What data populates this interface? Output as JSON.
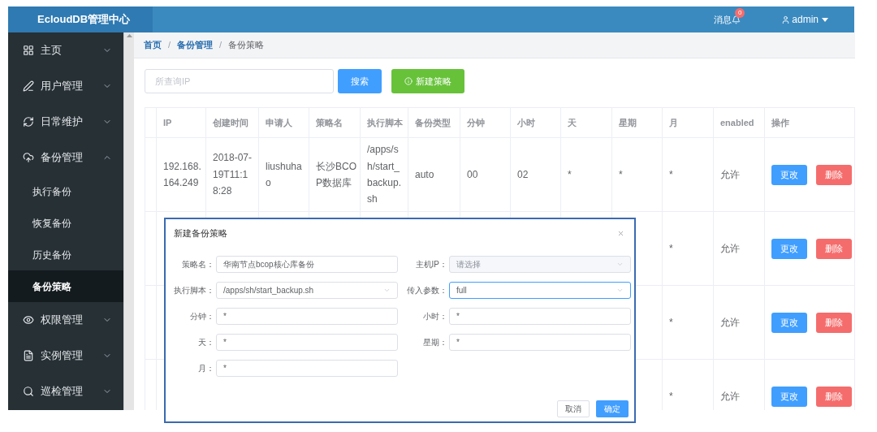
{
  "app": {
    "title": "EcloudDB管理中心"
  },
  "header": {
    "messages": {
      "label": "消息",
      "badge": "0"
    },
    "user": "admin"
  },
  "sidebar": {
    "items": [
      {
        "label": "主页",
        "expanded": false
      },
      {
        "label": "用户管理",
        "expanded": false
      },
      {
        "label": "日常维护",
        "expanded": false
      },
      {
        "label": "备份管理",
        "expanded": true,
        "children": [
          {
            "label": "执行备份",
            "selected": false
          },
          {
            "label": "恢复备份",
            "selected": false
          },
          {
            "label": "历史备份",
            "selected": false
          },
          {
            "label": "备份策略",
            "selected": true
          }
        ]
      },
      {
        "label": "权限管理",
        "expanded": false
      },
      {
        "label": "实例管理",
        "expanded": false
      },
      {
        "label": "巡检管理",
        "expanded": false
      }
    ]
  },
  "breadcrumb": [
    {
      "label": "首页",
      "current": false
    },
    {
      "separator": "/",
      "label": "备份管理",
      "current": false
    },
    {
      "separator": "/",
      "label": "备份策略",
      "current": true
    }
  ],
  "toolbar": {
    "search": {
      "placeholder": "所查询IP"
    },
    "buttons": [
      {
        "label": "搜索",
        "kind": "search"
      },
      {
        "label": "新建策略",
        "kind": "create"
      }
    ]
  },
  "table": {
    "columns": [
      "IP",
      "创建时间",
      "申请人",
      "策略名",
      "执行脚本",
      "备份类型",
      "分钟",
      "小时",
      "天",
      "星期",
      "月",
      "enabled",
      "操作"
    ],
    "rows": [
      {
        "cells": [
          "192.168.164.249",
          "2018-07-19T11:18:28",
          "liushuhao",
          "长沙BCOP数据库",
          "/apps/sh/start_backup.sh",
          "auto",
          "00",
          "02",
          "*",
          "*",
          "*",
          "允许"
        ],
        "actions": [
          {
            "label": "更改",
            "kind": "edit"
          },
          {
            "label": "删除",
            "kind": "delete"
          }
        ]
      },
      {
        "cells": [
          null,
          null,
          null,
          null,
          null,
          null,
          null,
          null,
          null,
          null,
          "*",
          "允许"
        ],
        "actions": [
          {
            "label": "更改",
            "kind": "edit"
          },
          {
            "label": "删除",
            "kind": "delete"
          }
        ]
      },
      {
        "cells": [
          null,
          null,
          null,
          null,
          null,
          null,
          null,
          null,
          null,
          null,
          "*",
          "允许"
        ],
        "actions": [
          {
            "label": "更改",
            "kind": "edit"
          },
          {
            "label": "删除",
            "kind": "delete"
          }
        ]
      },
      {
        "cells": [
          null,
          null,
          null,
          null,
          null,
          null,
          null,
          null,
          null,
          null,
          "*",
          "允许"
        ],
        "actions": [
          {
            "label": "更改",
            "kind": "edit"
          },
          {
            "label": "删除",
            "kind": "delete"
          }
        ]
      }
    ]
  },
  "dialog": {
    "title": "新建备份策略",
    "fields": [
      {
        "label": "策略名：",
        "kind": "input",
        "value": "华南节点bcop核心库备份",
        "focused": false
      },
      {
        "label": "主机IP：",
        "kind": "select",
        "placeholder": "请选择",
        "focused": false
      },
      {
        "label": "执行脚本：",
        "kind": "select",
        "value": "/apps/sh/start_backup.sh",
        "focused": false
      },
      {
        "label": "传入参数：",
        "kind": "select",
        "value": "full",
        "focused": true
      },
      {
        "label": "分钟：",
        "kind": "input",
        "value": "*",
        "focused": false
      },
      {
        "label": "小时：",
        "kind": "input",
        "value": "*",
        "focused": false
      },
      {
        "label": "天：",
        "kind": "input",
        "value": "*",
        "focused": false
      },
      {
        "label": "星期：",
        "kind": "input",
        "value": "*",
        "focused": false
      },
      {
        "label": "月：",
        "kind": "input",
        "value": "*",
        "focused": false
      }
    ],
    "buttons": [
      {
        "label": "取消",
        "kind": "cancel"
      },
      {
        "label": "确定",
        "kind": "confirm"
      }
    ]
  }
}
